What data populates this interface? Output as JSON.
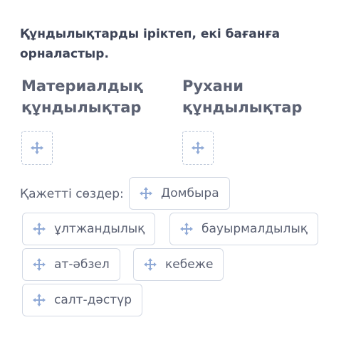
{
  "instruction": "Құндылықтарды іріктеп, екі бағанға орналастыр.",
  "columns": [
    {
      "heading_line1": "Материалдық",
      "heading_line2": "құндылықтар"
    },
    {
      "heading_line1": "Рухани",
      "heading_line2": "құндылықтар"
    }
  ],
  "words_label": "Қажетті сөздер:",
  "words": [
    {
      "label": "Домбыра"
    },
    {
      "label": "ұлтжандылық"
    },
    {
      "label": "бауырмалдылық"
    },
    {
      "label": "ат-әбзел"
    },
    {
      "label": "кебеже"
    },
    {
      "label": "салт-дәстүр"
    }
  ],
  "colors": {
    "icon": "#8fa9d6",
    "border": "#d3d9e4",
    "dropzone_border": "#b7c3d6"
  },
  "icons": {
    "drag": "move-arrows-icon"
  }
}
